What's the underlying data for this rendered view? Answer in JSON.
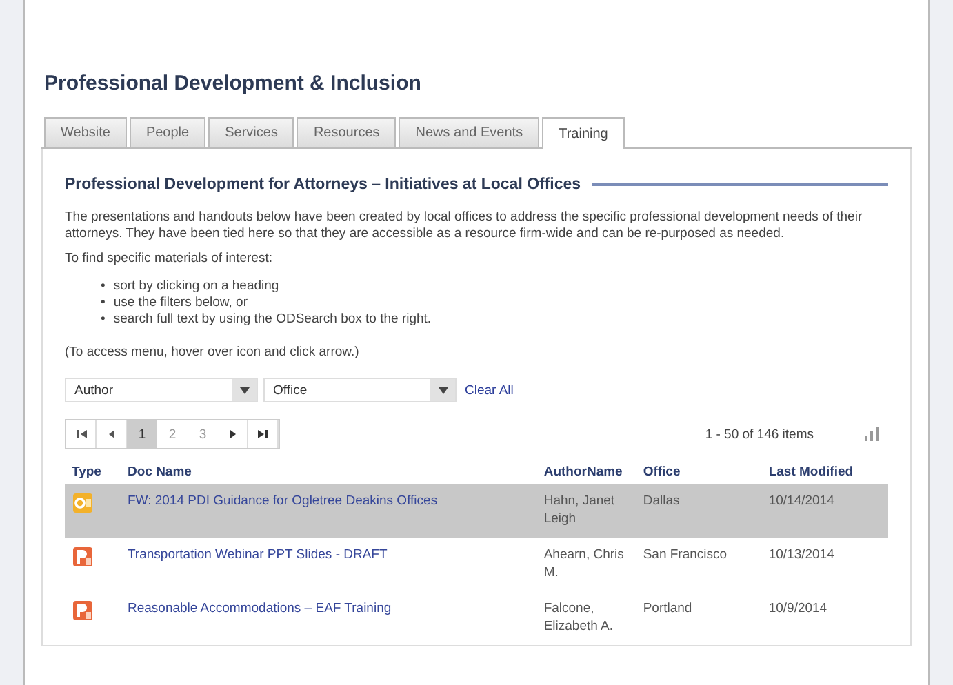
{
  "page_title": "Professional Development & Inclusion",
  "tabs": [
    {
      "label": "Website",
      "selected": false
    },
    {
      "label": "People",
      "selected": false
    },
    {
      "label": "Services",
      "selected": false
    },
    {
      "label": "Resources",
      "selected": false
    },
    {
      "label": "News and Events",
      "selected": false
    },
    {
      "label": "Training",
      "selected": true
    }
  ],
  "section_title": "Professional Development for Attorneys – Initiatives at Local Offices",
  "intro": "The presentations and handouts below have been created by local offices to address the specific professional development needs of their attorneys. They have been tied here so that they are accessible as a resource firm-wide and can be re-purposed as needed.",
  "find_label": "To find specific materials of interest:",
  "tips": [
    {
      "bullet": "•",
      "text": "sort by clicking on a heading"
    },
    {
      "bullet": "•",
      "text": "use the filters below, or"
    },
    {
      "bullet": "•",
      "text": "search full text by using the ODSearch box to the right."
    }
  ],
  "menu_hint": "(To access menu, hover over icon and click arrow.)",
  "filters": [
    {
      "value": "Author"
    },
    {
      "value": "Office"
    }
  ],
  "clear_all": "Clear All",
  "pager": {
    "pages": [
      {
        "label": "1",
        "selected": true
      },
      {
        "label": "2",
        "selected": false
      },
      {
        "label": "3",
        "selected": false
      }
    ],
    "count": "1 - 50 of 146 items"
  },
  "table": {
    "columns": [
      "Type",
      "Doc Name",
      "AuthorName",
      "Office",
      "Last Modified"
    ],
    "rows": [
      {
        "kind": "outlook",
        "name": "FW: 2014 PDI Guidance for Ogletree Deakins Offices",
        "author": "Hahn, Janet Leigh",
        "office": "Dallas",
        "modified": "10/14/2014",
        "selected": true
      },
      {
        "kind": "powerpoint",
        "name": "Transportation Webinar PPT Slides - DRAFT",
        "author": "Ahearn, Chris M.",
        "office": "San Francisco",
        "modified": "10/13/2014",
        "selected": false
      },
      {
        "kind": "powerpoint",
        "name": "Reasonable Accommodations – EAF Training",
        "author": "Falcone, Elizabeth A.",
        "office": "Portland",
        "modified": "10/9/2014",
        "selected": false
      }
    ]
  }
}
